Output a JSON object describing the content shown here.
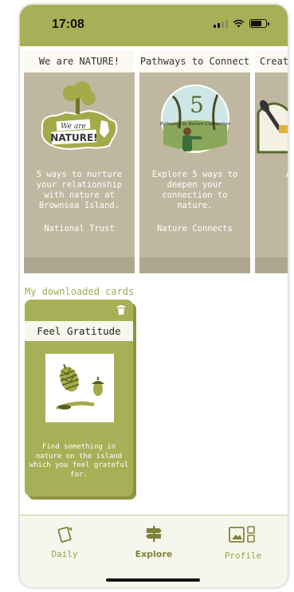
{
  "status": {
    "time": "17:08"
  },
  "carousel": [
    {
      "title": "We are NATURE!",
      "logo_text_1": "We are",
      "logo_text_2": "NATURE!",
      "description": "5 ways to nurture your relationship with nature at Brownsea Island.",
      "author": "National Trust"
    },
    {
      "title": "Pathways to Connect",
      "logo_number": "5",
      "logo_text": "Pathways to Nature Connection",
      "description": "Explore 5 ways to deepen your connection to nature.",
      "author": "Nature Connects"
    },
    {
      "title": "Creat",
      "description": "A c promp natu c",
      "author": "Ke"
    }
  ],
  "downloads": {
    "section_title": "My downloaded cards",
    "cards": [
      {
        "title": "Feel Gratitude",
        "description": "Find something in nature on the island which you feel grateful for."
      }
    ]
  },
  "tabs": [
    {
      "label": "Daily",
      "icon": "cards-icon"
    },
    {
      "label": "Explore",
      "icon": "signpost-icon",
      "active": true
    },
    {
      "label": "Profile",
      "icon": "gallery-icon"
    }
  ],
  "colors": {
    "accent": "#a7b057",
    "card_bg": "#c0b7a0",
    "tab_bg": "#f6f6ec"
  }
}
